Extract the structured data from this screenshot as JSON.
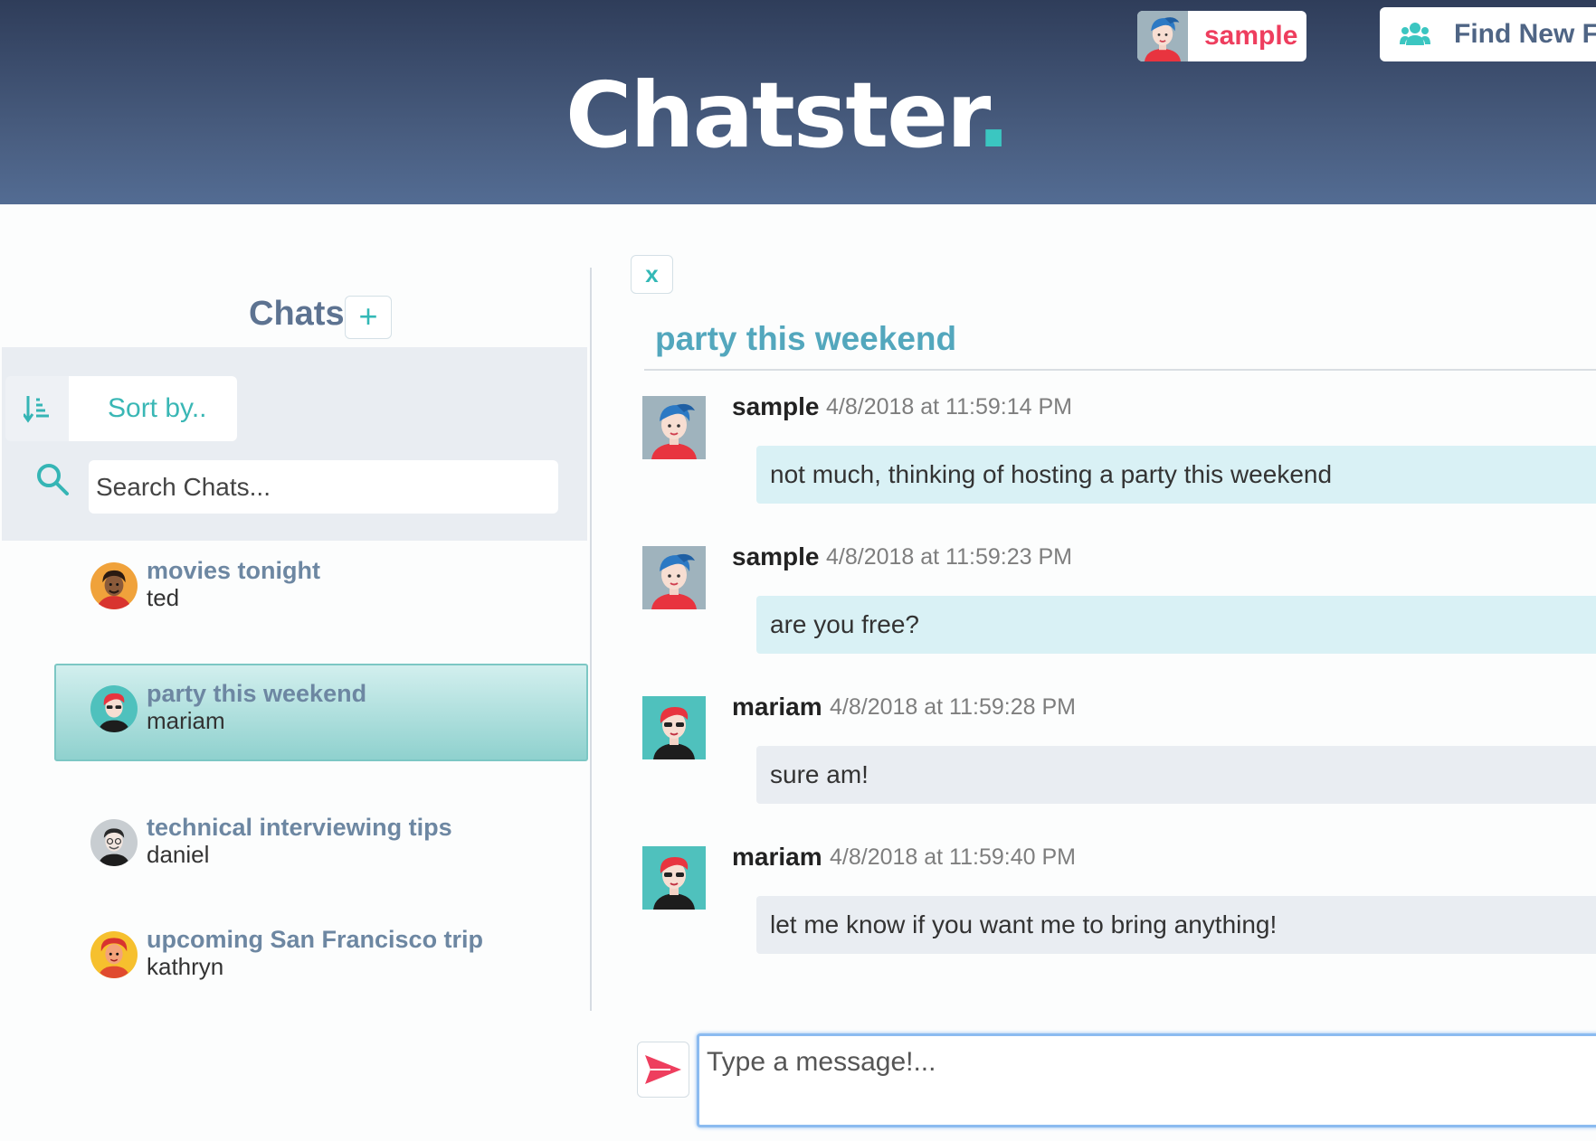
{
  "header": {
    "brand": "Chatster",
    "brand_dot": ".",
    "user": {
      "name": "sample"
    },
    "find_friends_label": "Find New Fr"
  },
  "sidebar": {
    "title": "Chats",
    "add_label": "+",
    "sort_label": "Sort by..",
    "search_placeholder": "Search Chats...",
    "chats": [
      {
        "title": "movies tonight",
        "user": "ted"
      },
      {
        "title": "party this weekend",
        "user": "mariam",
        "active": true
      },
      {
        "title": "technical interviewing tips",
        "user": "daniel"
      },
      {
        "title": "upcoming San Francisco trip",
        "user": "kathryn"
      }
    ]
  },
  "conversation": {
    "close_label": "x",
    "title": "party this weekend",
    "messages": [
      {
        "user": "sample",
        "time": "4/8/2018 at 11:59:14 PM",
        "text": "not much, thinking of hosting a party this weekend"
      },
      {
        "user": "sample",
        "time": "4/8/2018 at 11:59:23 PM",
        "text": "are you free?"
      },
      {
        "user": "mariam",
        "time": "4/8/2018 at 11:59:28 PM",
        "text": "sure am!"
      },
      {
        "user": "mariam",
        "time": "4/8/2018 at 11:59:40 PM",
        "text": "let me know if you want me to bring anything!"
      }
    ],
    "input_placeholder": "Type a message!..."
  },
  "colors": {
    "accent_teal": "#3bc6c1",
    "brand_red": "#ee3e5e",
    "header_dark": "#2f3d5a",
    "header_light": "#536c93"
  }
}
